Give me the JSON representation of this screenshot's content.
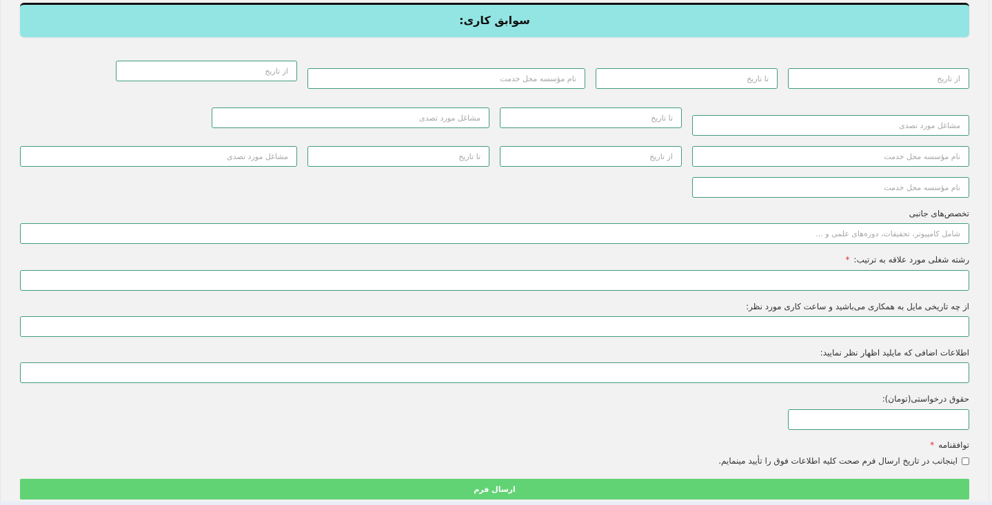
{
  "section": {
    "title": "سوابق کاری:"
  },
  "work_history": {
    "placeholders": {
      "from_date": "از تاریخ",
      "to_date": "تا تاریخ",
      "institution": "نام مؤسسه محل خدمت",
      "position": "مشاغل مورد تصدی"
    }
  },
  "side_skills": {
    "label": "تخصص‌های جانبی",
    "placeholder": "شامل کامپیوتر، تحقیقات، دوره‌های علمی و ..."
  },
  "job_field": {
    "label": "رشته شغلی مورد علاقه به ترتیب:",
    "required_mark": "*"
  },
  "availability": {
    "label": "از چه تاریخی مایل به همکاری می‌باشید و ساعت کاری مورد نظر:"
  },
  "additional_info": {
    "label": "اطلاعات اضافی که مایلید اظهار نظر نمایید:"
  },
  "salary": {
    "label": "حقوق درخواستی(تومان):"
  },
  "agreement": {
    "label": "توافقنامه",
    "required_mark": "*",
    "checkbox_text": "اینجانب در تاریخ ارسال فرم صحت کلیه اطلاعات فوق را تأیید مینمایم."
  },
  "submit": {
    "label": "ارسال فرم"
  }
}
